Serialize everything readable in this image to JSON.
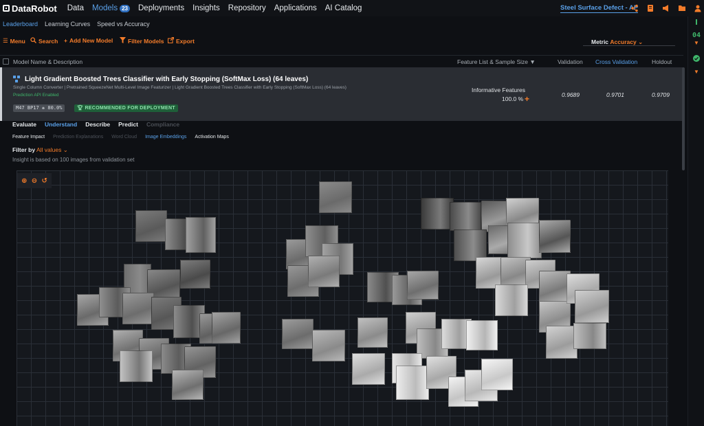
{
  "nav": {
    "logo": "DataRobot",
    "items": [
      {
        "label": "Data"
      },
      {
        "label": "Models",
        "badge": "23"
      },
      {
        "label": "Deployments"
      },
      {
        "label": "Insights"
      },
      {
        "label": "Repository"
      },
      {
        "label": "Applications"
      },
      {
        "label": "AI Catalog"
      }
    ],
    "project": "Steel Surface Defect - AP"
  },
  "rail": {
    "count": "04"
  },
  "subtabs": [
    {
      "label": "Leaderboard"
    },
    {
      "label": "Learning Curves"
    },
    {
      "label": "Speed vs Accuracy"
    }
  ],
  "toolbar": {
    "menu": "Menu",
    "search": "Search",
    "add": "Add New Model",
    "filter": "Filter Models",
    "export": "Export",
    "metric_label": "Metric",
    "metric_value": "Accuracy"
  },
  "columns": {
    "name": "Model Name & Description",
    "featurelist": "Feature List & Sample Size",
    "validation": "Validation",
    "cross_validation": "Cross Validation",
    "holdout": "Holdout"
  },
  "model": {
    "title": "Light Gradient Boosted Trees Classifier with Early Stopping (SoftMax Loss) (64 leaves)",
    "description": "Single Column Converter | Pretrained SqueezeNet Multi-Level Image Featurizer | Light Gradient Boosted Trees Classifier with Early Stopping (SoftMax Loss) (64 leaves)",
    "api": "Prediction API Enabled",
    "tag_id": "M47  BP17  ❋ 80.0%",
    "tag_recommended": "RECOMMENDED FOR DEPLOYMENT",
    "feature_list": "Informative Features",
    "sample_size": "100.0 %",
    "validation": "0.9689",
    "cross_validation": "0.9701",
    "holdout": "0.9709"
  },
  "insight_tabs": [
    {
      "label": "Evaluate"
    },
    {
      "label": "Understand"
    },
    {
      "label": "Describe"
    },
    {
      "label": "Predict"
    },
    {
      "label": "Compliance"
    }
  ],
  "sub_insights": [
    {
      "label": "Feature Impact"
    },
    {
      "label": "Prediction Explanations"
    },
    {
      "label": "Word Cloud"
    },
    {
      "label": "Image Embeddings"
    },
    {
      "label": "Activation Maps"
    }
  ],
  "filter": {
    "label": "Filter by",
    "value": "All values"
  },
  "note": "Insight is based on 100 images from validation set",
  "colors": {
    "accent": "#f47c2a",
    "link": "#5aa0e8",
    "success": "#3fb56a"
  }
}
